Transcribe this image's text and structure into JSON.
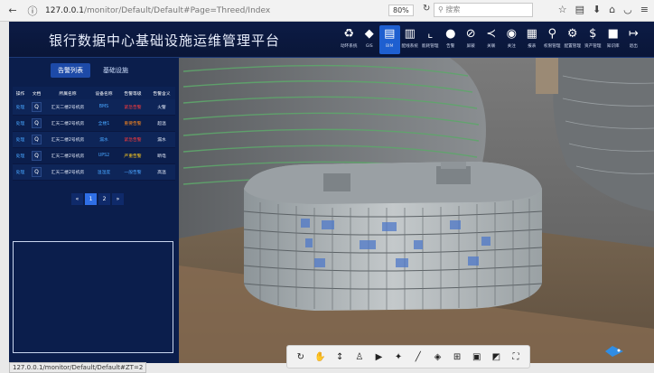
{
  "browser": {
    "url_host": "127.0.0.1",
    "url_path": "/monitor/Default/Default#Page=Threed/Index",
    "zoom": "80%",
    "search_placeholder": "搜索"
  },
  "app": {
    "title": "银行数据中心基础设施运维管理平台",
    "tools": [
      {
        "label": "动环系统",
        "icon": "network-icon",
        "glyph": "♻"
      },
      {
        "label": "GIS",
        "icon": "cube-icon",
        "glyph": "◆"
      },
      {
        "label": "BIM",
        "icon": "document-icon",
        "glyph": "▤",
        "active": true
      },
      {
        "label": "配线系统",
        "icon": "bookmark-icon",
        "glyph": "▥"
      },
      {
        "label": "能耗管理",
        "icon": "chart-icon",
        "glyph": "⌞"
      },
      {
        "label": "告警",
        "icon": "alarm-icon",
        "glyph": "●"
      },
      {
        "label": "屏蔽",
        "icon": "block-icon",
        "glyph": "⊘"
      },
      {
        "label": "关联",
        "icon": "share-icon",
        "glyph": "≺"
      },
      {
        "label": "关注",
        "icon": "target-icon",
        "glyph": "◉"
      },
      {
        "label": "报表",
        "icon": "report-icon",
        "glyph": "▦"
      },
      {
        "label": "权限管理",
        "icon": "key-icon",
        "glyph": "⚲"
      },
      {
        "label": "配置管理",
        "icon": "gear-icon",
        "glyph": "⚙"
      },
      {
        "label": "资产管理",
        "icon": "dollar-icon",
        "glyph": "$"
      },
      {
        "label": "知识库",
        "icon": "book-icon",
        "glyph": "■"
      },
      {
        "label": "退出",
        "icon": "logout-icon",
        "glyph": "↦"
      }
    ]
  },
  "left": {
    "tabs": [
      "告警列表",
      "基础设施"
    ],
    "headers": [
      "操作",
      "文档",
      "所属名称",
      "设备名称",
      "告警等级",
      "告警含义"
    ],
    "rows": [
      {
        "op": "处理",
        "name": "汇天二楼2号机房",
        "device": "BMS",
        "level": "紧急告警",
        "meaning": "火警",
        "level_color": "#ff3b3b"
      },
      {
        "op": "处理",
        "name": "汇天二楼2号机房",
        "device": "全楼1",
        "level": "重要告警",
        "meaning": "超温",
        "level_color": "#ff8a1e"
      },
      {
        "op": "处理",
        "name": "汇天二楼2号机房",
        "device": "漏水",
        "level": "紧急告警",
        "meaning": "漏水",
        "level_color": "#ff3b3b"
      },
      {
        "op": "处理",
        "name": "汇天二楼2号机房",
        "device": "UPS2",
        "level": "严重告警",
        "meaning": "断电",
        "level_color": "#ffcc1e"
      },
      {
        "op": "处理",
        "name": "汇天二楼2号机房",
        "device": "温湿度",
        "level": "一般告警",
        "meaning": "高温",
        "level_color": "#4aa3ff"
      }
    ],
    "pager": [
      "«",
      "1",
      "2",
      "»"
    ]
  },
  "status_url": "127.0.0.1/monitor/Default/Default#ZT=2",
  "bottom_tools": [
    {
      "name": "rotate-icon",
      "glyph": "↻"
    },
    {
      "name": "pan-icon",
      "glyph": "✋"
    },
    {
      "name": "vertical-move-icon",
      "glyph": "↕"
    },
    {
      "name": "walk-icon",
      "glyph": "♙"
    },
    {
      "name": "camera-icon",
      "glyph": "▶"
    },
    {
      "name": "explode-icon",
      "glyph": "✦"
    },
    {
      "name": "measure-icon",
      "glyph": "╱"
    },
    {
      "name": "section-icon",
      "glyph": "◈"
    },
    {
      "name": "tree-icon",
      "glyph": "⊞"
    },
    {
      "name": "properties-icon",
      "glyph": "▣"
    },
    {
      "name": "settings-icon",
      "glyph": "◩"
    },
    {
      "name": "fullscreen-icon",
      "glyph": "⛶"
    }
  ]
}
